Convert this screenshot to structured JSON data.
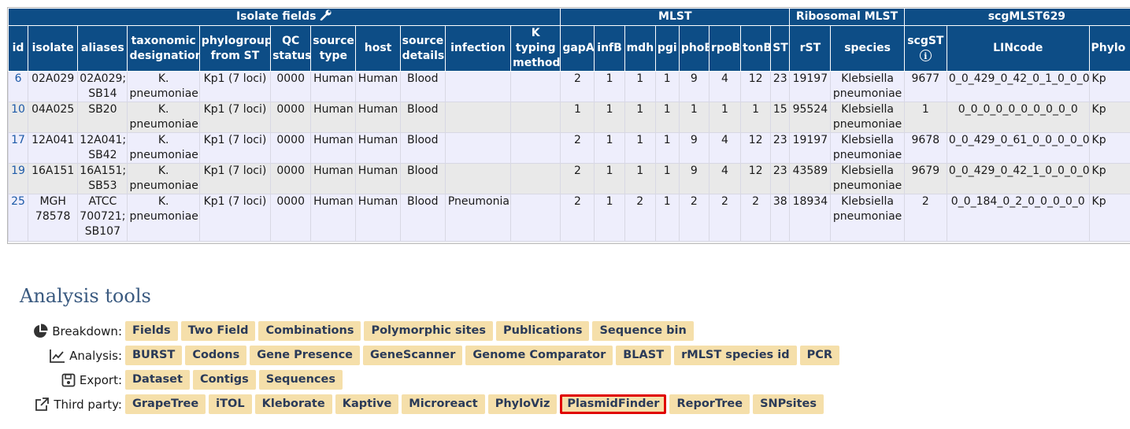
{
  "table": {
    "groups": [
      {
        "label": "Isolate fields",
        "icon": "wrench-icon"
      },
      {
        "label": "MLST"
      },
      {
        "label": "Ribosomal MLST"
      },
      {
        "label": "scgMLST629"
      }
    ],
    "columns": [
      "id",
      "isolate",
      "aliases",
      "taxonomic designation",
      "phylogroup from ST",
      "QC status",
      "source type",
      "host",
      "source details",
      "infection",
      "K typing method",
      "gapA",
      "infB",
      "mdh",
      "pgi",
      "phoE",
      "rpoB",
      "tonB",
      "ST",
      "rST",
      "species",
      "scgST",
      "LINcode",
      "Phylo"
    ],
    "scgst_info_icon": "info-icon",
    "rows": [
      {
        "id": "6",
        "isolate": "02A029",
        "aliases": "02A029; SB14",
        "taxonomic_designation": "K. pneumoniae",
        "phylogroup": "Kp1 (7 loci)",
        "qc": "0000",
        "source_type": "Human",
        "host": "Human",
        "source_details": "Blood",
        "infection": "",
        "k_typing": "",
        "gapA": "2",
        "infB": "1",
        "mdh": "1",
        "pgi": "1",
        "phoE": "9",
        "rpoB": "4",
        "tonB": "12",
        "st": "23",
        "rst": "19197",
        "species": "Klebsiella pneumoniae",
        "scgst": "9677",
        "lincode": "0_0_429_0_42_0_1_0_0_0",
        "phylo": "Kp"
      },
      {
        "id": "10",
        "isolate": "04A025",
        "aliases": "SB20",
        "taxonomic_designation": "K. pneumoniae",
        "phylogroup": "Kp1 (7 loci)",
        "qc": "0000",
        "source_type": "Human",
        "host": "Human",
        "source_details": "Blood",
        "infection": "",
        "k_typing": "",
        "gapA": "1",
        "infB": "1",
        "mdh": "1",
        "pgi": "1",
        "phoE": "1",
        "rpoB": "1",
        "tonB": "1",
        "st": "15",
        "rst": "95524",
        "species": "Klebsiella pneumoniae",
        "scgst": "1",
        "lincode": "0_0_0_0_0_0_0_0_0_0",
        "phylo": "Kp"
      },
      {
        "id": "17",
        "isolate": "12A041",
        "aliases": "12A041; SB42",
        "taxonomic_designation": "K. pneumoniae",
        "phylogroup": "Kp1 (7 loci)",
        "qc": "0000",
        "source_type": "Human",
        "host": "Human",
        "source_details": "Blood",
        "infection": "",
        "k_typing": "",
        "gapA": "2",
        "infB": "1",
        "mdh": "1",
        "pgi": "1",
        "phoE": "9",
        "rpoB": "4",
        "tonB": "12",
        "st": "23",
        "rst": "19197",
        "species": "Klebsiella pneumoniae",
        "scgst": "9678",
        "lincode": "0_0_429_0_61_0_0_0_0_0",
        "phylo": "Kp"
      },
      {
        "id": "19",
        "isolate": "16A151",
        "aliases": "16A151; SB53",
        "taxonomic_designation": "K. pneumoniae",
        "phylogroup": "Kp1 (7 loci)",
        "qc": "0000",
        "source_type": "Human",
        "host": "Human",
        "source_details": "Blood",
        "infection": "",
        "k_typing": "",
        "gapA": "2",
        "infB": "1",
        "mdh": "1",
        "pgi": "1",
        "phoE": "9",
        "rpoB": "4",
        "tonB": "12",
        "st": "23",
        "rst": "43589",
        "species": "Klebsiella pneumoniae",
        "scgst": "9679",
        "lincode": "0_0_429_0_42_1_0_0_0_0",
        "phylo": "Kp"
      },
      {
        "id": "25",
        "isolate": "MGH 78578",
        "aliases": "ATCC 700721; SB107",
        "taxonomic_designation": "K. pneumoniae",
        "phylogroup": "Kp1 (7 loci)",
        "qc": "0000",
        "source_type": "Human",
        "host": "Human",
        "source_details": "Blood",
        "infection": "Pneumonia",
        "k_typing": "",
        "gapA": "2",
        "infB": "1",
        "mdh": "2",
        "pgi": "1",
        "phoE": "2",
        "rpoB": "2",
        "tonB": "2",
        "st": "38",
        "rst": "18934",
        "species": "Klebsiella pneumoniae",
        "scgst": "2",
        "lincode": "0_0_184_0_2_0_0_0_0_0",
        "phylo": "Kp"
      }
    ]
  },
  "analysis": {
    "title": "Analysis tools",
    "rows": [
      {
        "label": "Breakdown:",
        "icon": "pie-chart-icon",
        "tools": [
          "Fields",
          "Two Field",
          "Combinations",
          "Polymorphic sites",
          "Publications",
          "Sequence bin"
        ]
      },
      {
        "label": "Analysis:",
        "icon": "line-chart-icon",
        "tools": [
          "BURST",
          "Codons",
          "Gene Presence",
          "GeneScanner",
          "Genome Comparator",
          "BLAST",
          "rMLST species id",
          "PCR"
        ]
      },
      {
        "label": "Export:",
        "icon": "save-icon",
        "tools": [
          "Dataset",
          "Contigs",
          "Sequences"
        ]
      },
      {
        "label": "Third party:",
        "icon": "external-link-icon",
        "tools": [
          "GrapeTree",
          "iTOL",
          "Kleborate",
          "Kaptive",
          "Microreact",
          "PhyloViz",
          "PlasmidFinder",
          "ReporTree",
          "SNPsites"
        ]
      }
    ],
    "selected_tool": "PlasmidFinder",
    "colors": {
      "header_bg": "#0d4d86",
      "button_bg": "#f5dfaa",
      "button_text": "#2a3a58",
      "selection_outline": "#e00000",
      "link": "#1d5aa8"
    }
  }
}
